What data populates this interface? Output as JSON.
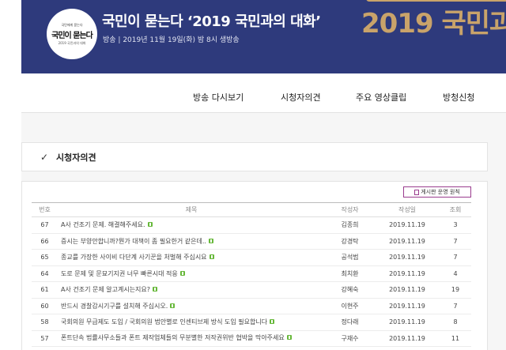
{
  "banner": {
    "logo_top": "국민에게 묻는다",
    "logo_main": "국민이 묻는다",
    "logo_sub": "2019 국민과의 대화",
    "title": "국민이 묻는다 ‘2019 국민과의 대화’",
    "airtime": "방송 | 2019년 11월 19일(화) 밤 8시 생방송",
    "deco_text": "2019 국민과의"
  },
  "nav": {
    "items": [
      "방송 다시보기",
      "시청자의견",
      "주요 영상클립",
      "방청신청"
    ]
  },
  "section": {
    "title": "시청자의견"
  },
  "board": {
    "rules_button": "게시판 운영 원칙",
    "columns": [
      "번호",
      "제목",
      "작성자",
      "작성일",
      "조회"
    ],
    "rows": [
      {
        "num": "67",
        "title": "A사 건조기 문제. 해결해주세요.",
        "author": "김종희",
        "date": "2019.11.19",
        "views": "3"
      },
      {
        "num": "66",
        "title": "증시는 부양안합니까?뭔가 대책이 좀 필요한거 같은데..",
        "author": "강경탁",
        "date": "2019.11.19",
        "views": "7"
      },
      {
        "num": "65",
        "title": "종교를 가장한 사이비 다단계 사기꾼을 처벌해 주십시요",
        "author": "공석범",
        "date": "2019.11.19",
        "views": "7"
      },
      {
        "num": "64",
        "title": "도로 문제 및 문묘기지권 너무 빠른시대 적응",
        "author": "최치환",
        "date": "2019.11.19",
        "views": "4"
      },
      {
        "num": "61",
        "title": "A사 건조기 문제 알고계시는지요?",
        "author": "강혜숙",
        "date": "2019.11.19",
        "views": "19"
      },
      {
        "num": "60",
        "title": "반드시 경찰감시기구를 설치해 주십시오.",
        "author": "이현주",
        "date": "2019.11.19",
        "views": "7"
      },
      {
        "num": "58",
        "title": "국회의원 무급제도 도입 / 국회의원 법안별로 인센티브제 방식 도입 필요합니다",
        "author": "정다래",
        "date": "2019.11.19",
        "views": "8"
      },
      {
        "num": "57",
        "title": "폰트단속 법률사무소들과 폰트 제작업체들의 무분별한 저작권위반 협박을 막아주세요",
        "author": "구재수",
        "date": "2019.11.19",
        "views": "11"
      }
    ]
  }
}
